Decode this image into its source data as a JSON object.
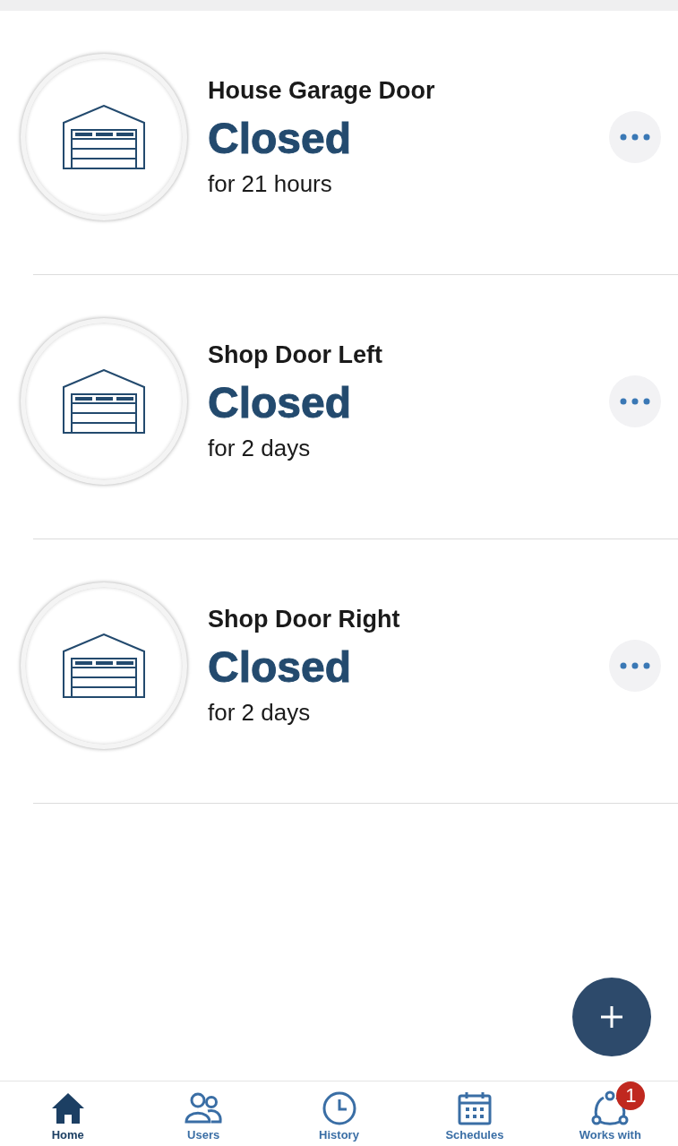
{
  "doors": [
    {
      "name": "House Garage Door",
      "status": "Closed",
      "duration": "for 21 hours"
    },
    {
      "name": "Shop Door Left",
      "status": "Closed",
      "duration": "for 2 days"
    },
    {
      "name": "Shop Door Right",
      "status": "Closed",
      "duration": "for 2 days"
    }
  ],
  "tab_bar": [
    {
      "label": "Home",
      "kind": "home",
      "selected": true
    },
    {
      "label": "Users",
      "kind": "users",
      "selected": false
    },
    {
      "label": "History",
      "kind": "history",
      "selected": false
    },
    {
      "label": "Schedules",
      "kind": "schedules",
      "selected": false
    },
    {
      "label": "Works with",
      "kind": "works",
      "selected": false,
      "badge": "1"
    }
  ]
}
